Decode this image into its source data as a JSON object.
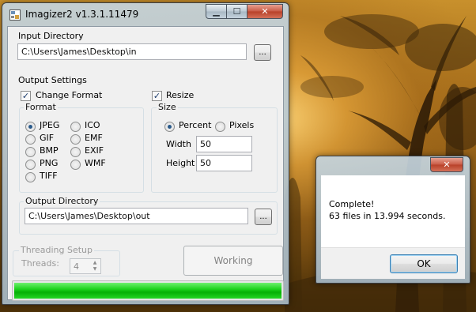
{
  "main_window": {
    "title": "Imagizer2 v1.3.1.11479",
    "caption_buttons": {
      "minimize": "▁",
      "maximize": "☐",
      "close": "✕"
    },
    "input_directory": {
      "label": "Input Directory",
      "value": "C:\\Users\\James\\Desktop\\in",
      "browse_label": "..."
    },
    "output_settings": {
      "label": "Output Settings",
      "change_format": {
        "label": "Change Format",
        "checked": true
      },
      "format": {
        "label": "Format",
        "options": [
          "JPEG",
          "GIF",
          "BMP",
          "PNG",
          "TIFF",
          "ICO",
          "EMF",
          "EXIF",
          "WMF"
        ],
        "selected": "JPEG"
      },
      "resize": {
        "label": "Resize",
        "checked": true
      },
      "size": {
        "label": "Size",
        "modes": [
          "Percent",
          "Pixels"
        ],
        "selected_mode": "Percent",
        "width_label": "Width",
        "width_value": "50",
        "height_label": "Height",
        "height_value": "50"
      },
      "output_directory": {
        "label": "Output Directory",
        "value": "C:\\Users\\James\\Desktop\\out",
        "browse_label": "..."
      }
    },
    "threading": {
      "label": "Threading Setup",
      "threads_label": "Threads:",
      "threads_value": "4"
    },
    "working_button_label": "Working",
    "progress_fraction": 1.0
  },
  "message_box": {
    "title": "",
    "close_glyph": "✕",
    "line1": "Complete!",
    "line2": "63 files in 13.994 seconds.",
    "ok_label": "OK"
  },
  "colors": {
    "progress_green": "#1ed31e",
    "window_glass": "#b4c6d2",
    "client_bg": "#f0f0f0"
  }
}
